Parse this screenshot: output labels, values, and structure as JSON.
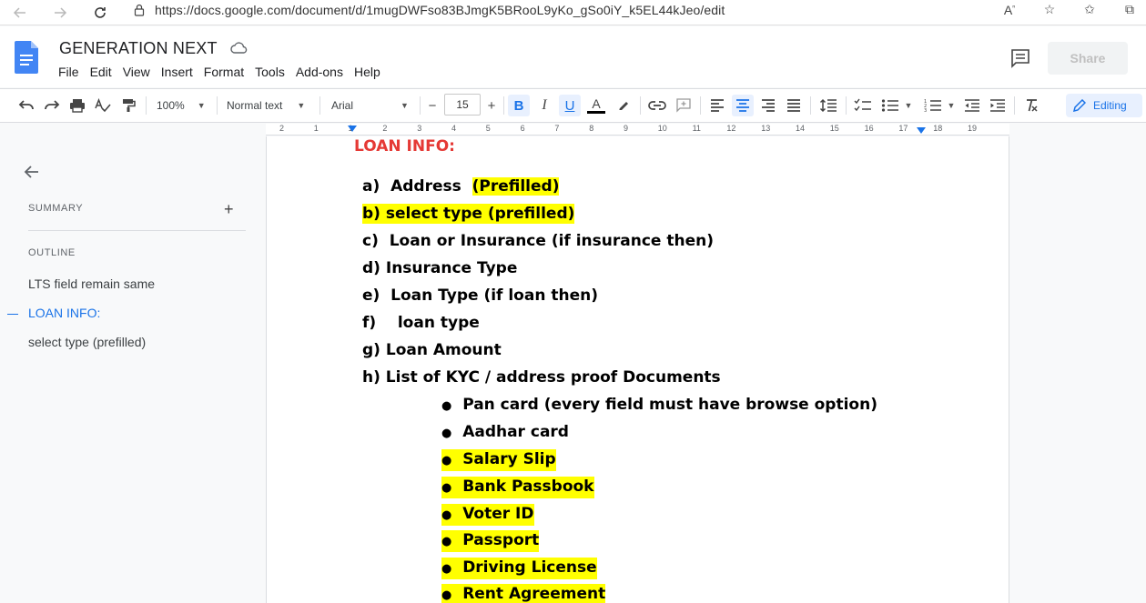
{
  "browser": {
    "url": "https://docs.google.com/document/d/1mugDWFso83BJmgK5BRooL9yKo_gSo0iY_k5EL44kJeo/edit",
    "back_icon": "arrow-left",
    "forward_icon": "arrow-right",
    "refresh_icon": "refresh",
    "lock_icon": "lock"
  },
  "docs": {
    "title": "GENERATION NEXT",
    "menu": [
      "File",
      "Edit",
      "View",
      "Insert",
      "Format",
      "Tools",
      "Add-ons",
      "Help"
    ],
    "share_label": "Share"
  },
  "toolbar": {
    "zoom": "100%",
    "style": "Normal text",
    "font": "Arial",
    "font_size": "15",
    "mode": "Editing",
    "minus": "−",
    "plus": "+",
    "bold": "B",
    "italic": "I",
    "underline": "U",
    "text_color": "A",
    "text_color_value": "#000000"
  },
  "ruler": {
    "marks": [
      "2",
      "1",
      "1",
      "2",
      "3",
      "4",
      "5",
      "6",
      "7",
      "8",
      "9",
      "10",
      "11",
      "12",
      "13",
      "14",
      "15",
      "16",
      "17",
      "18",
      "19"
    ]
  },
  "outline_panel": {
    "summary_label": "SUMMARY",
    "add_summary": "+",
    "outline_label": "OUTLINE",
    "items": [
      {
        "label": "LTS field remain same",
        "active": false
      },
      {
        "label": "LOAN INFO:",
        "active": true
      },
      {
        "label": "select type (prefilled)",
        "active": false
      }
    ]
  },
  "document": {
    "heading": "LOAN INFO:",
    "heading_color": "#e53935",
    "highlight_color": "#ffff00",
    "list": [
      {
        "marker": "a)",
        "text": "Address",
        "extra": "(Prefilled)"
      },
      {
        "marker": "b)",
        "text": "select type (prefilled)"
      },
      {
        "marker": "c)",
        "text": "Loan or Insurance (if insurance then)"
      },
      {
        "marker": "d)",
        "text": "Insurance Type"
      },
      {
        "marker": "e)",
        "text": "Loan Type (if loan then)"
      },
      {
        "marker": "f)",
        "text": "loan type"
      },
      {
        "marker": "g)",
        "text": "Loan Amount"
      },
      {
        "marker": "h)",
        "text": "List of KYC / address proof Documents"
      }
    ],
    "bullets": [
      {
        "text": "Pan card (every field must have browse option)",
        "highlight": false
      },
      {
        "text": "Aadhar card",
        "highlight": false
      },
      {
        "text": "Salary Slip",
        "highlight": true
      },
      {
        "text": "Bank Passbook",
        "highlight": true
      },
      {
        "text": "Voter ID",
        "highlight": true
      },
      {
        "text": "Passport",
        "highlight": true
      },
      {
        "text": "Driving License",
        "highlight": true
      },
      {
        "text": "Rent Agreement",
        "highlight": true
      }
    ],
    "bullet_glyph": "●"
  }
}
